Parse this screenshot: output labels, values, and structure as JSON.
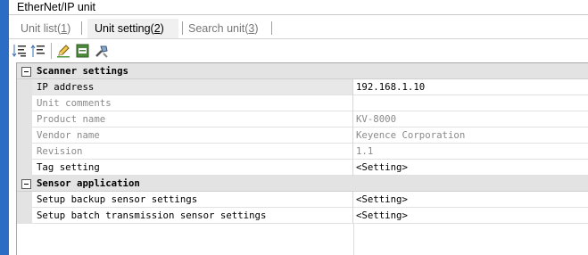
{
  "window": {
    "title": "EtherNet/IP unit"
  },
  "tabs": [
    {
      "label": "Unit list",
      "hotkey": "1",
      "active": false
    },
    {
      "label": "Unit setting",
      "hotkey": "2",
      "active": true
    },
    {
      "label": "Search unit",
      "hotkey": "3",
      "active": false
    }
  ],
  "toolbar": {
    "buttons": [
      {
        "icon": "collapse-all-icon"
      },
      {
        "icon": "expand-all-icon"
      },
      {
        "icon": "edit-pencil-icon"
      },
      {
        "icon": "eds-file-icon"
      },
      {
        "icon": "tools-icon"
      }
    ]
  },
  "grid": {
    "sections": [
      {
        "title": "Scanner settings",
        "rows": [
          {
            "label": "IP address",
            "value": "192.168.1.10",
            "enabled": true,
            "selected": true
          },
          {
            "label": "Unit comments",
            "value": "",
            "enabled": false
          },
          {
            "label": "Product name",
            "value": "KV-8000",
            "enabled": false
          },
          {
            "label": "Vendor name",
            "value": "Keyence Corporation",
            "enabled": false
          },
          {
            "label": "Revision",
            "value": "1.1",
            "enabled": false
          },
          {
            "label": "Tag setting",
            "value": "<Setting>",
            "enabled": true
          }
        ]
      },
      {
        "title": "Sensor application",
        "rows": [
          {
            "label": "Setup backup sensor settings",
            "value": "<Setting>",
            "enabled": true
          },
          {
            "label": "Setup batch transmission sensor settings",
            "value": "<Setting>",
            "enabled": true
          }
        ]
      }
    ]
  }
}
